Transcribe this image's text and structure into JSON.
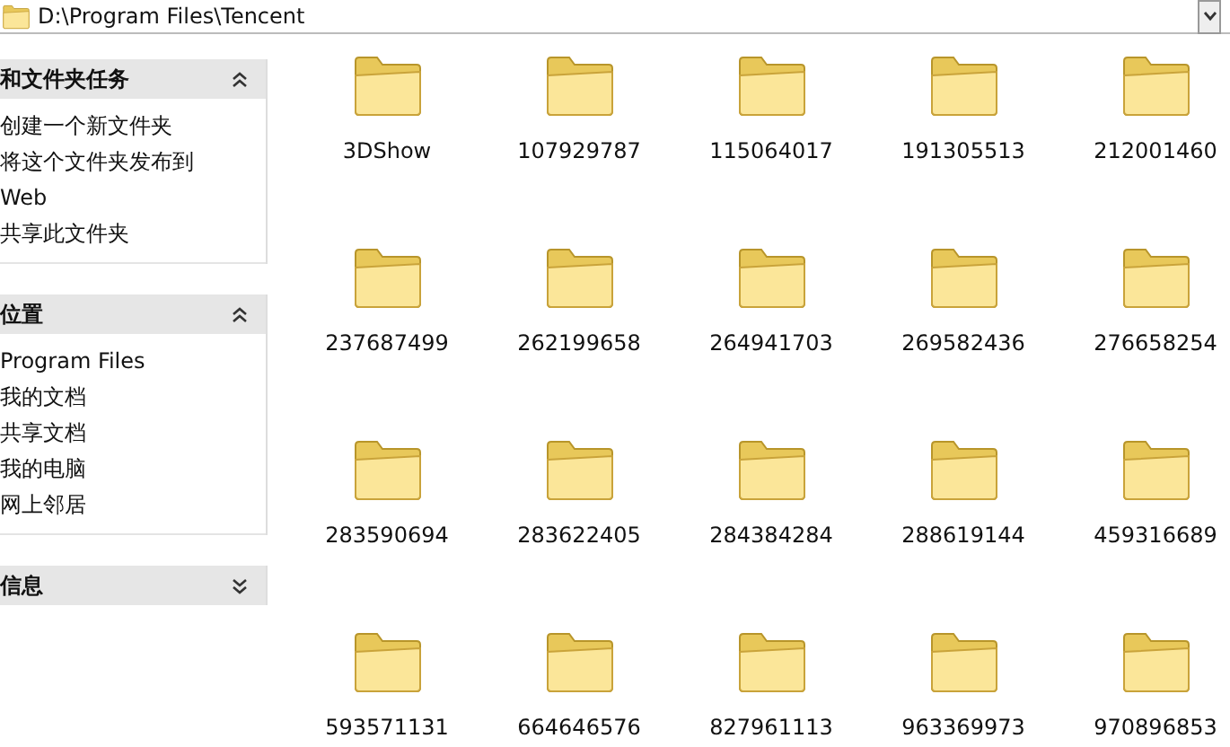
{
  "address_bar": {
    "path": "D:\\Program Files\\Tencent"
  },
  "sidebar": {
    "sections": [
      {
        "title": "和文件夹任务",
        "expanded": true,
        "items": [
          "创建一个新文件夹",
          "将这个文件夹发布到\nWeb",
          "共享此文件夹"
        ]
      },
      {
        "title": "位置",
        "expanded": true,
        "items": [
          "Program Files",
          "我的文档",
          "共享文档",
          "我的电脑",
          "网上邻居"
        ]
      },
      {
        "title": "信息",
        "expanded": false
      }
    ]
  },
  "folders": [
    "3DShow",
    "107929787",
    "115064017",
    "191305513",
    "212001460",
    "237687499",
    "262199658",
    "264941703",
    "269582436",
    "276658254",
    "283590694",
    "283622405",
    "284384284",
    "288619144",
    "459316689",
    "593571131",
    "664646576",
    "827961113",
    "963369973",
    "970896853"
  ]
}
